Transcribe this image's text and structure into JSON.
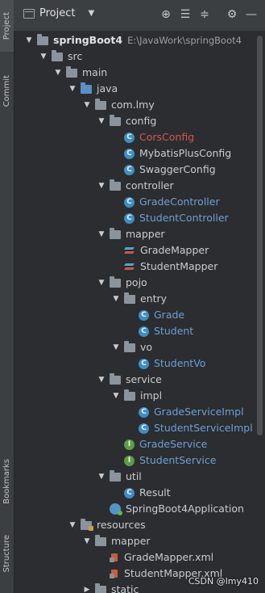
{
  "sidebar_tabs": {
    "project": "Project",
    "commit": "Commit",
    "bookmarks": "Bookmarks",
    "structure": "Structure"
  },
  "toolbar": {
    "title": "Project",
    "buttons": [
      "locate-icon",
      "collapse-all-icon",
      "expand-all-icon",
      "gear-icon",
      "hide-icon"
    ]
  },
  "tree": [
    {
      "label": "springBoot4",
      "path": "E:\\JavaWork\\springBoot4",
      "kind": "root",
      "depth": 0,
      "expanded": true
    },
    {
      "label": "src",
      "kind": "folder",
      "depth": 1,
      "expanded": true
    },
    {
      "label": "main",
      "kind": "folder",
      "depth": 2,
      "expanded": true
    },
    {
      "label": "java",
      "kind": "folder-blue",
      "depth": 3,
      "expanded": true
    },
    {
      "label": "com.lmy",
      "kind": "folder",
      "depth": 4,
      "expanded": true
    },
    {
      "label": "config",
      "kind": "folder",
      "depth": 5,
      "expanded": true
    },
    {
      "label": "CorsConfig",
      "kind": "class-error",
      "depth": 6
    },
    {
      "label": "MybatisPlusConfig",
      "kind": "class",
      "depth": 6
    },
    {
      "label": "SwaggerConfig",
      "kind": "class",
      "depth": 6
    },
    {
      "label": "controller",
      "kind": "folder",
      "depth": 5,
      "expanded": true
    },
    {
      "label": "GradeController",
      "kind": "class-blue",
      "depth": 6
    },
    {
      "label": "StudentController",
      "kind": "class-blue",
      "depth": 6
    },
    {
      "label": "mapper",
      "kind": "folder",
      "depth": 5,
      "expanded": true
    },
    {
      "label": "GradeMapper",
      "kind": "mapper",
      "depth": 6
    },
    {
      "label": "StudentMapper",
      "kind": "mapper",
      "depth": 6
    },
    {
      "label": "pojo",
      "kind": "folder",
      "depth": 5,
      "expanded": true
    },
    {
      "label": "entry",
      "kind": "folder",
      "depth": 6,
      "expanded": true
    },
    {
      "label": "Grade",
      "kind": "class-blue",
      "depth": 7
    },
    {
      "label": "Student",
      "kind": "class-blue",
      "depth": 7
    },
    {
      "label": "vo",
      "kind": "folder",
      "depth": 6,
      "expanded": true
    },
    {
      "label": "StudentVo",
      "kind": "class-blue",
      "depth": 7
    },
    {
      "label": "service",
      "kind": "folder",
      "depth": 5,
      "expanded": true
    },
    {
      "label": "impl",
      "kind": "folder",
      "depth": 6,
      "expanded": true
    },
    {
      "label": "GradeServiceImpl",
      "kind": "class-blue",
      "depth": 7
    },
    {
      "label": "StudentServiceImpl",
      "kind": "class-blue",
      "depth": 7
    },
    {
      "label": "GradeService",
      "kind": "interface",
      "depth": 6
    },
    {
      "label": "StudentService",
      "kind": "interface",
      "depth": 6
    },
    {
      "label": "util",
      "kind": "folder",
      "depth": 5,
      "expanded": true
    },
    {
      "label": "Result",
      "kind": "class",
      "depth": 6
    },
    {
      "label": "SpringBoot4Application",
      "kind": "springboot",
      "depth": 5
    },
    {
      "label": "resources",
      "kind": "folder-res",
      "depth": 3,
      "expanded": true
    },
    {
      "label": "mapper",
      "kind": "folder",
      "depth": 4,
      "expanded": true
    },
    {
      "label": "GradeMapper.xml",
      "kind": "xml",
      "depth": 5
    },
    {
      "label": "StudentMapper.xml",
      "kind": "xml",
      "depth": 5
    },
    {
      "label": "static",
      "kind": "folder",
      "depth": 4,
      "expanded": false
    }
  ],
  "watermark": "CSDN @lmy410"
}
